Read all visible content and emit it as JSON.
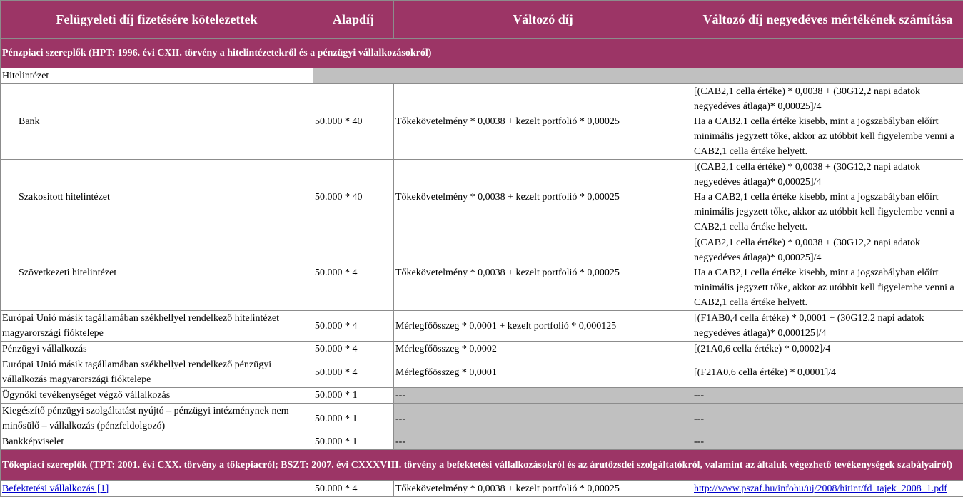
{
  "headers": [
    "Felügyeleti díj fizetésére kötelezettek",
    "Alapdíj",
    "Változó díj",
    "Változó díj negyedéves mértékének számítása"
  ],
  "section1": "Pénzpiaci szereplők (HPT: 1996. évi CXII. törvény a hitelintézetekről és a pénzügyi vállalkozásokról)",
  "hitelintezet": "Hitelintézet",
  "bank": {
    "name": "Bank",
    "alapdij": "50.000 * 40",
    "valtozo": "Tőkekövetelmény * 0,0038 + kezelt portfolió * 0,00025",
    "szamitas": "[(CAB2,1 cella értéke) * 0,0038 + (30G12,2 napi adatok negyedéves átlaga)* 0,00025]/4",
    "szamitas2": "Ha a CAB2,1 cella értéke kisebb, mint a jogszabályban előírt minimális jegyzett tőke, akkor az utóbbit kell figyelembe venni a CAB2,1 cella értéke helyett."
  },
  "szakositott": {
    "name": "Szakositott hitelintézet",
    "alapdij": "50.000 * 40",
    "valtozo": "Tőkekövetelmény * 0,0038 + kezelt portfolió * 0,00025",
    "szamitas": "[(CAB2,1 cella értéke) * 0,0038 + (30G12,2 napi adatok negyedéves átlaga)* 0,00025]/4",
    "szamitas2": "Ha a CAB2,1 cella értéke kisebb, mint a jogszabályban előírt minimális jegyzett tőke, akkor az utóbbit kell figyelembe venni a CAB2,1 cella értéke helyett."
  },
  "szovetkezeti": {
    "name": "Szövetkezeti hitelintézet",
    "alapdij": "50.000 * 4",
    "valtozo": "Tőkekövetelmény * 0,0038 + kezelt portfolió * 0,00025",
    "szamitas": "[(CAB2,1 cella értéke) * 0,0038 + (30G12,2 napi adatok negyedéves átlaga)* 0,00025]/4",
    "szamitas2": "Ha a CAB2,1 cella értéke kisebb, mint a jogszabályban előírt minimális jegyzett tőke, akkor az utóbbit kell figyelembe venni a CAB2,1 cella értéke helyett."
  },
  "eu_hitel": {
    "name": "Európai Unió másik tagállamában székhellyel rendelkező hitelintézet magyarországi fióktelepe",
    "alapdij": "50.000 * 4",
    "valtozo": "Mérlegfőösszeg * 0,0001 + kezelt portfolió * 0,000125",
    "szamitas": "[(F1AB0,4 cella értéke) * 0,0001 + (30G12,2 napi adatok negyedéves átlaga)* 0,000125]/4"
  },
  "penzugyi": {
    "name": "Pénzügyi vállalkozás",
    "alapdij": "50.000 * 4",
    "valtozo": "Mérlegfőösszeg * 0,0002",
    "szamitas": "[(21A0,6 cella értéke) * 0,0002]/4"
  },
  "eu_penzugyi": {
    "name": "Európai Unió másik tagállamában székhellyel rendelkező pénzügyi vállalkozás magyarországi fióktelepe",
    "alapdij": "50.000 * 4",
    "valtozo": "Mérlegfőösszeg * 0,0001",
    "szamitas": "[(F21A0,6 cella értéke) * 0,0001]/4"
  },
  "ugynoki": {
    "name": "Ügynöki tevékenységet végző vállalkozás",
    "alapdij": "50.000 * 1",
    "valtozo": "---",
    "szamitas": "---"
  },
  "kiegeszito": {
    "name": "Kiegészítő pénzügyi szolgáltatást nyújtó – pénzügyi intézménynek nem minősülő – vállalkozás (pénzfeldolgozó)",
    "alapdij": "50.000 * 1",
    "valtozo": "---",
    "szamitas": "---"
  },
  "bankkep": {
    "name": "Bankképviselet",
    "alapdij": "50.000 * 1",
    "valtozo": "---",
    "szamitas": "---"
  },
  "section2": "Tőkepiaci szereplők (TPT: 2001. évi CXX. törvény a tőkepiacról; BSZT: 2007. évi CXXXVIII. törvény a befektetési vállalkozásokról és az árutőzsdei szolgáltatókról, valamint az általuk végezhető tevékenységek szabályairól)",
  "befektetesi": {
    "name": "Befektetési vállalkozás [1]",
    "alapdij": "50.000 * 4",
    "valtozo": "Tőkekövetelmény * 0,0038 + kezelt portfolió * 0,00025",
    "link": "http://www.pszaf.hu/infohu/uj/2008/hitint/fd_tajek_2008_1.pdf"
  }
}
